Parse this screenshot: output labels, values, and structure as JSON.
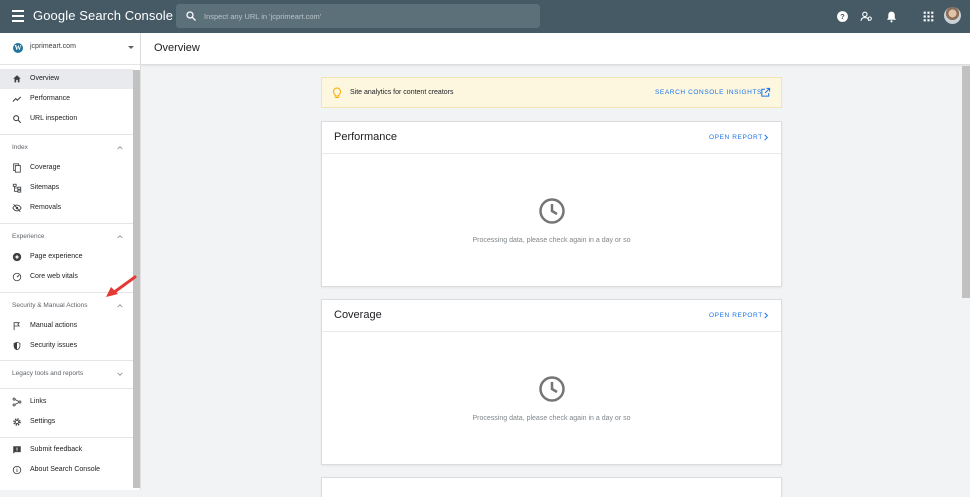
{
  "header": {
    "logo": "Google Search Console",
    "search_placeholder": "Inspect any URL in 'jcprimeart.com'"
  },
  "property": {
    "name": "jcprimeart.com"
  },
  "sidebar": {
    "top_items": [
      {
        "label": "Overview"
      },
      {
        "label": "Performance"
      },
      {
        "label": "URL inspection"
      }
    ],
    "sections": [
      {
        "title": "Index",
        "items": [
          {
            "label": "Coverage"
          },
          {
            "label": "Sitemaps"
          },
          {
            "label": "Removals"
          }
        ]
      },
      {
        "title": "Experience",
        "items": [
          {
            "label": "Page experience"
          },
          {
            "label": "Core web vitals"
          }
        ]
      },
      {
        "title": "Security & Manual Actions",
        "items": [
          {
            "label": "Manual actions"
          },
          {
            "label": "Security issues"
          }
        ]
      },
      {
        "title": "Legacy tools and reports",
        "items": []
      }
    ],
    "bottom_items": [
      {
        "label": "Links"
      },
      {
        "label": "Settings"
      },
      {
        "label": "Submit feedback"
      },
      {
        "label": "About Search Console"
      }
    ]
  },
  "main": {
    "title": "Overview",
    "banner": {
      "text": "Site analytics for content creators",
      "link": "SEARCH CONSOLE INSIGHTS"
    },
    "cards": [
      {
        "title": "Performance",
        "action": "OPEN REPORT",
        "message": "Processing data, please check again in a day or so"
      },
      {
        "title": "Coverage",
        "action": "OPEN REPORT",
        "message": "Processing data, please check again in a day or so"
      }
    ]
  },
  "colors": {
    "topbar": "#455a64",
    "accent": "#1a73e8",
    "banner": "#fef7e0",
    "annotation_arrow": "#e53935"
  }
}
